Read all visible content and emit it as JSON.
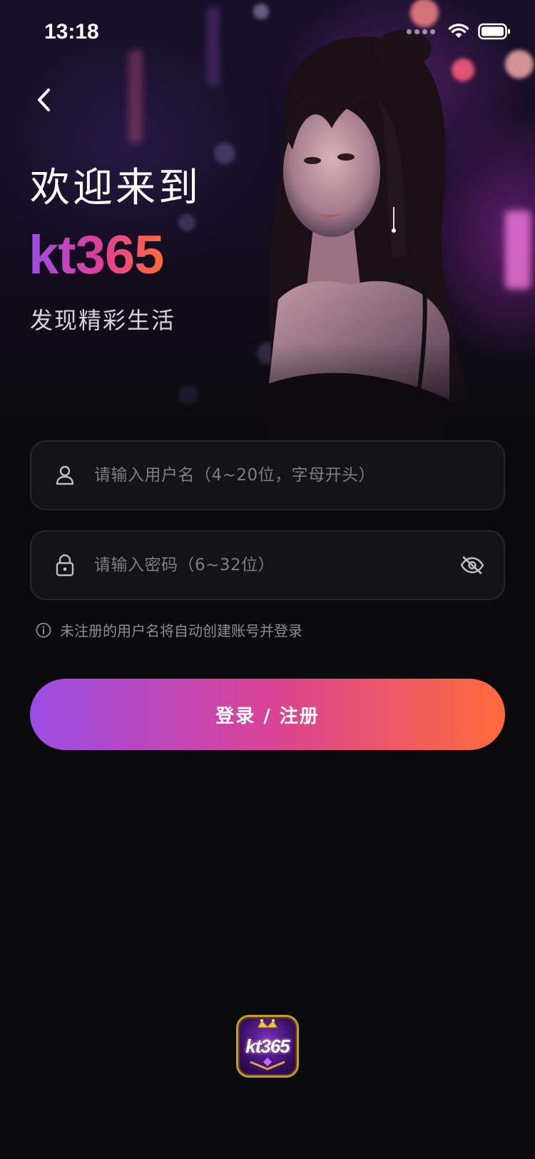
{
  "status_bar": {
    "time": "13:18"
  },
  "header": {
    "welcome": "欢迎来到",
    "brand": "kt365",
    "tagline": "发现精彩生活"
  },
  "form": {
    "username": {
      "placeholder": "请输入用户名（4~20位，字母开头）",
      "value": ""
    },
    "password": {
      "placeholder": "请输入密码（6~32位）",
      "value": ""
    },
    "hint": "未注册的用户名将自动创建账号并登录",
    "submit_label": "登录 / 注册"
  },
  "footer": {
    "logo_text": "kt365"
  },
  "colors": {
    "background": "#0b0b0e",
    "gradient_start": "#9b4de6",
    "gradient_mid": "#d84396",
    "gradient_end": "#ff6b3a",
    "field_background": "#141416",
    "placeholder": "#7d7d84"
  },
  "icons": {
    "back": "chevron-left-icon",
    "username": "user-icon",
    "password": "lock-icon",
    "toggle_visibility": "eye-off-icon",
    "hint": "info-icon",
    "wifi": "wifi-icon",
    "battery": "battery-icon"
  }
}
